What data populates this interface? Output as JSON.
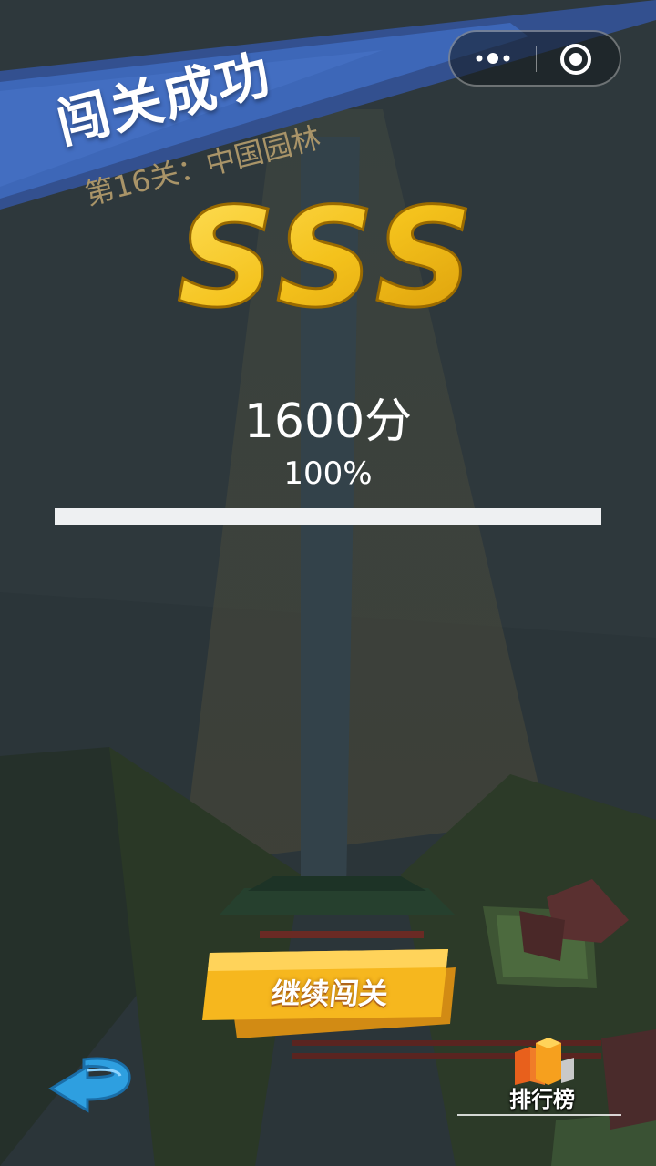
{
  "header": {
    "title": "闯关成功",
    "level_label": "第16关：中国园林"
  },
  "result": {
    "rank": "SSS",
    "score_text": "1600分",
    "percent_text": "100%",
    "progress": 1.0
  },
  "actions": {
    "continue_label": "继续闯关",
    "leaderboard_label": "排行榜"
  },
  "icons": {
    "menu": "more-dots-icon",
    "close": "close-circle-icon",
    "back": "back-arrow-icon",
    "leaderboard": "leaderboard-blocks-icon"
  },
  "colors": {
    "banner": "#3d67b8",
    "rank_gold": "#f4c21c",
    "button_gold": "#f6b71e",
    "progress_fill": "#eef0f2",
    "back_blue": "#2e9fe0"
  }
}
